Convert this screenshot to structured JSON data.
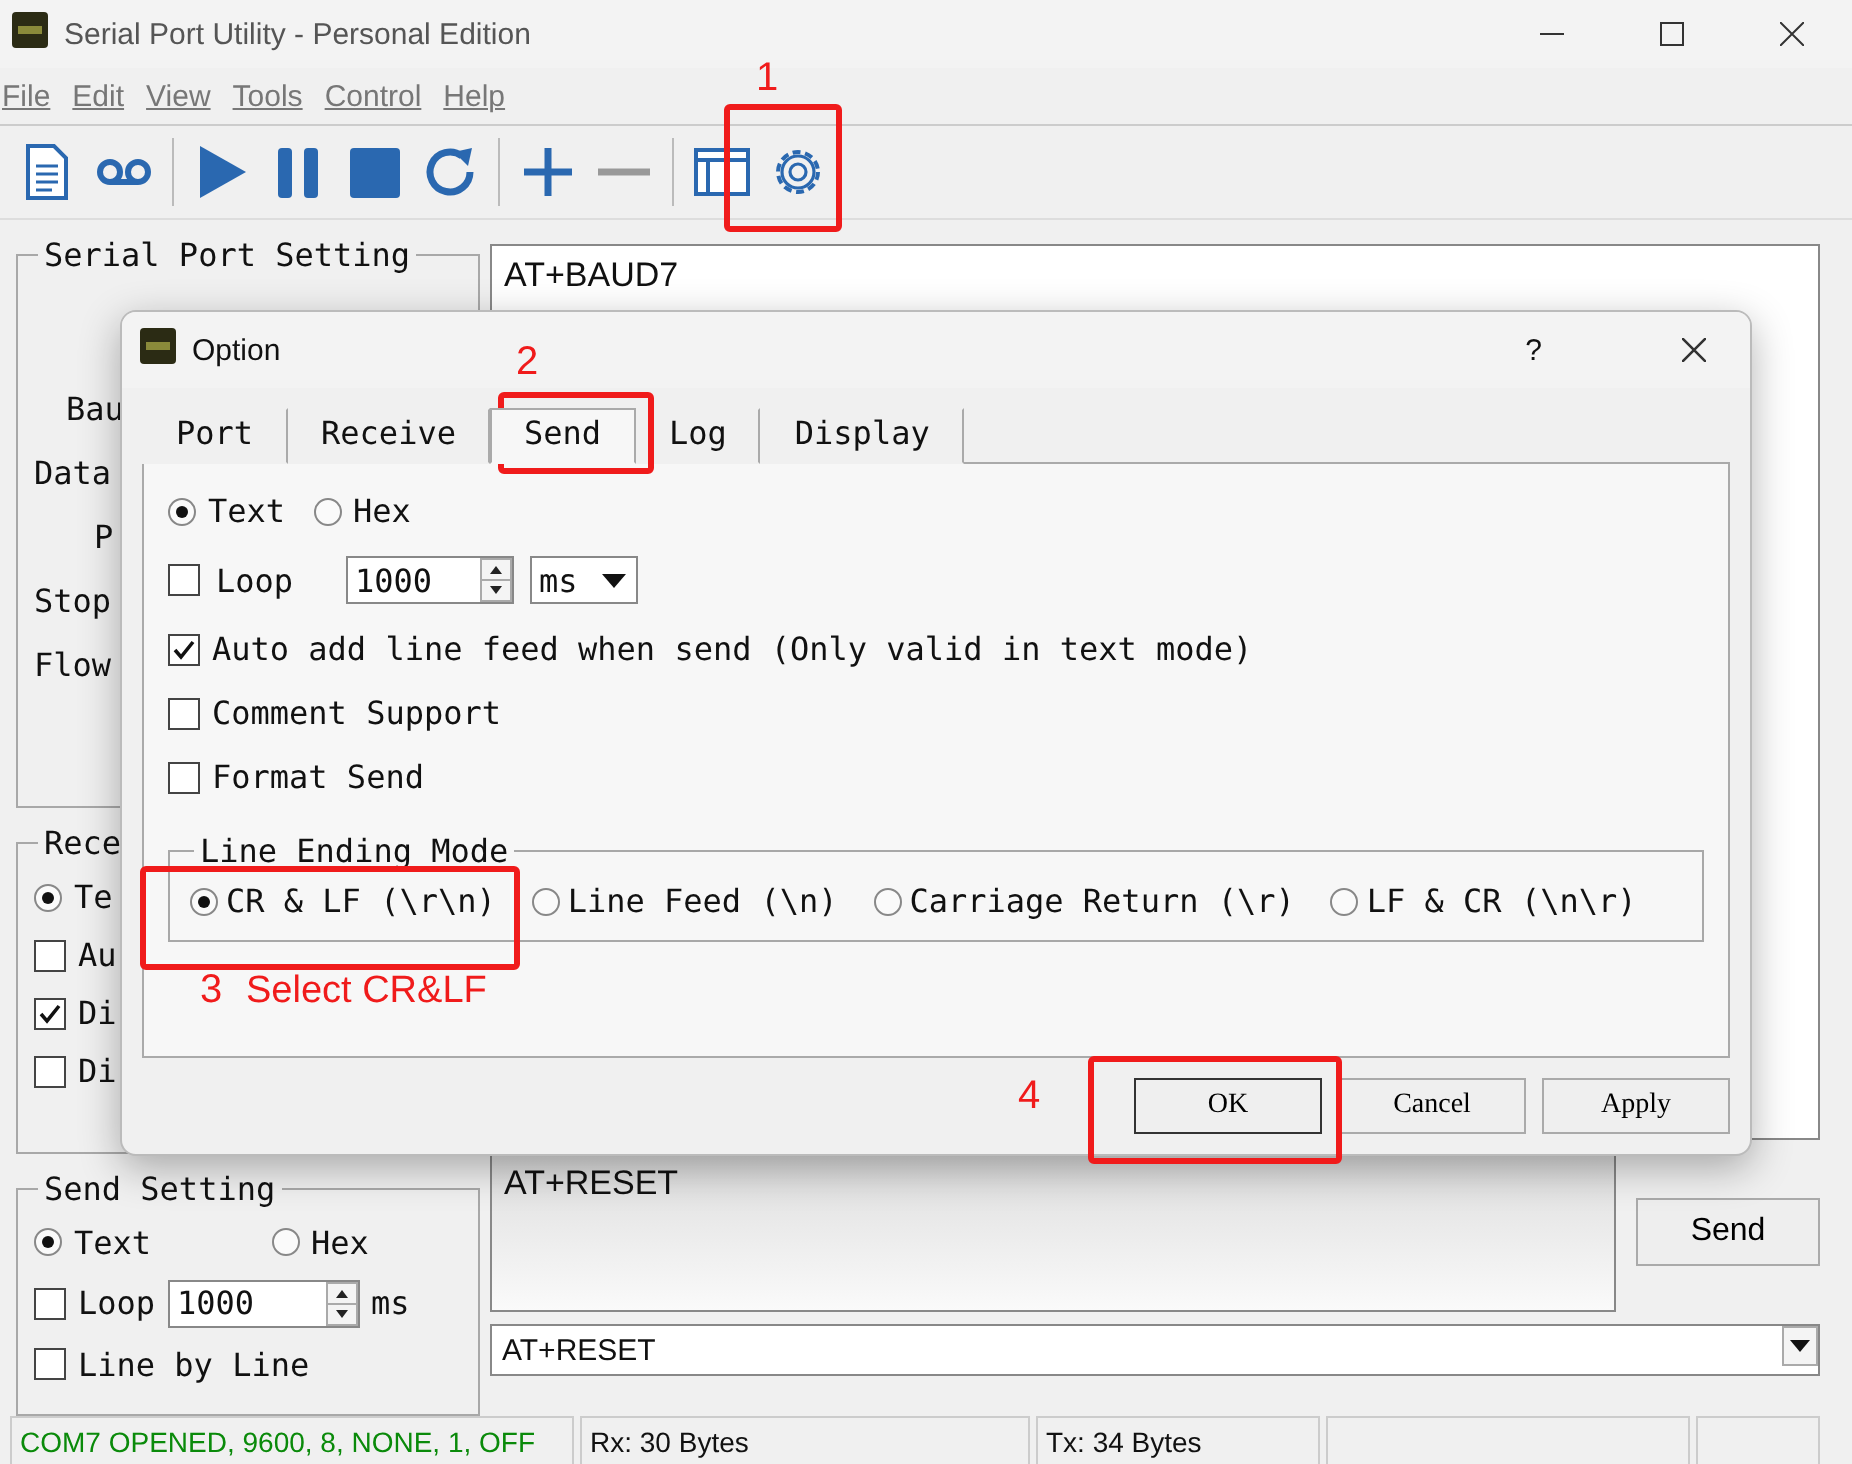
{
  "window": {
    "title": "Serial Port Utility - Personal Edition"
  },
  "menu": [
    "File",
    "Edit",
    "View",
    "Tools",
    "Control",
    "Help"
  ],
  "serial_port_setting": {
    "title": "Serial Port Setting",
    "labels": [
      "Bau",
      "Data",
      "P",
      "Stop",
      "Flow"
    ]
  },
  "receive_setting": {
    "title": "Rece",
    "options": [
      {
        "kind": "radio",
        "label": "Te",
        "checked": true
      },
      {
        "kind": "checkbox",
        "label": "Au",
        "checked": false
      },
      {
        "kind": "checkbox",
        "label": "Di",
        "checked": true
      },
      {
        "kind": "checkbox",
        "label": "Di",
        "checked": false
      }
    ]
  },
  "send_setting": {
    "title": "Send Setting",
    "mode": [
      {
        "label": "Text",
        "selected": true
      },
      {
        "label": "Hex",
        "selected": false
      }
    ],
    "loop": {
      "label": "Loop",
      "checked": false,
      "value": "1000",
      "unit": "ms"
    },
    "line_by_line": {
      "label": "Line by Line",
      "checked": false
    }
  },
  "receive_area": {
    "text": "AT+BAUD7"
  },
  "send_area": {
    "text": "AT+RESET"
  },
  "send_button": "Send",
  "history_combo": {
    "value": "AT+RESET"
  },
  "status_bar": [
    "COM7 OPENED, 9600, 8, NONE, 1, OFF",
    "Rx: 30 Bytes",
    "Tx: 34 Bytes"
  ],
  "dialog": {
    "title": "Option",
    "help": "?",
    "tabs": [
      {
        "label": "Port",
        "selected": false
      },
      {
        "label": "Receive",
        "selected": false
      },
      {
        "label": "Send",
        "selected": true
      },
      {
        "label": "Log",
        "selected": false
      },
      {
        "label": "Display",
        "selected": false
      }
    ],
    "mode": [
      {
        "label": "Text",
        "selected": true
      },
      {
        "label": "Hex",
        "selected": false
      }
    ],
    "loop": {
      "label": "Loop",
      "checked": false,
      "value": "1000",
      "unit": "ms"
    },
    "options": [
      {
        "label": "Auto add line feed when send (Only valid in text mode)",
        "checked": true
      },
      {
        "label": "Comment Support",
        "checked": false
      },
      {
        "label": "Format Send",
        "checked": false
      }
    ],
    "line_ending": {
      "title": "Line Ending Mode",
      "options": [
        {
          "label": "CR & LF (\\r\\n)",
          "selected": true
        },
        {
          "label": "Line Feed (\\n)",
          "selected": false
        },
        {
          "label": "Carriage Return (\\r)",
          "selected": false
        },
        {
          "label": "LF & CR (\\n\\r)",
          "selected": false
        }
      ]
    },
    "buttons": [
      "OK",
      "Cancel",
      "Apply"
    ]
  },
  "annotations": [
    {
      "label": "1"
    },
    {
      "label": "2"
    },
    {
      "label": "3",
      "note": "Select CR&LF"
    },
    {
      "label": "4"
    }
  ]
}
